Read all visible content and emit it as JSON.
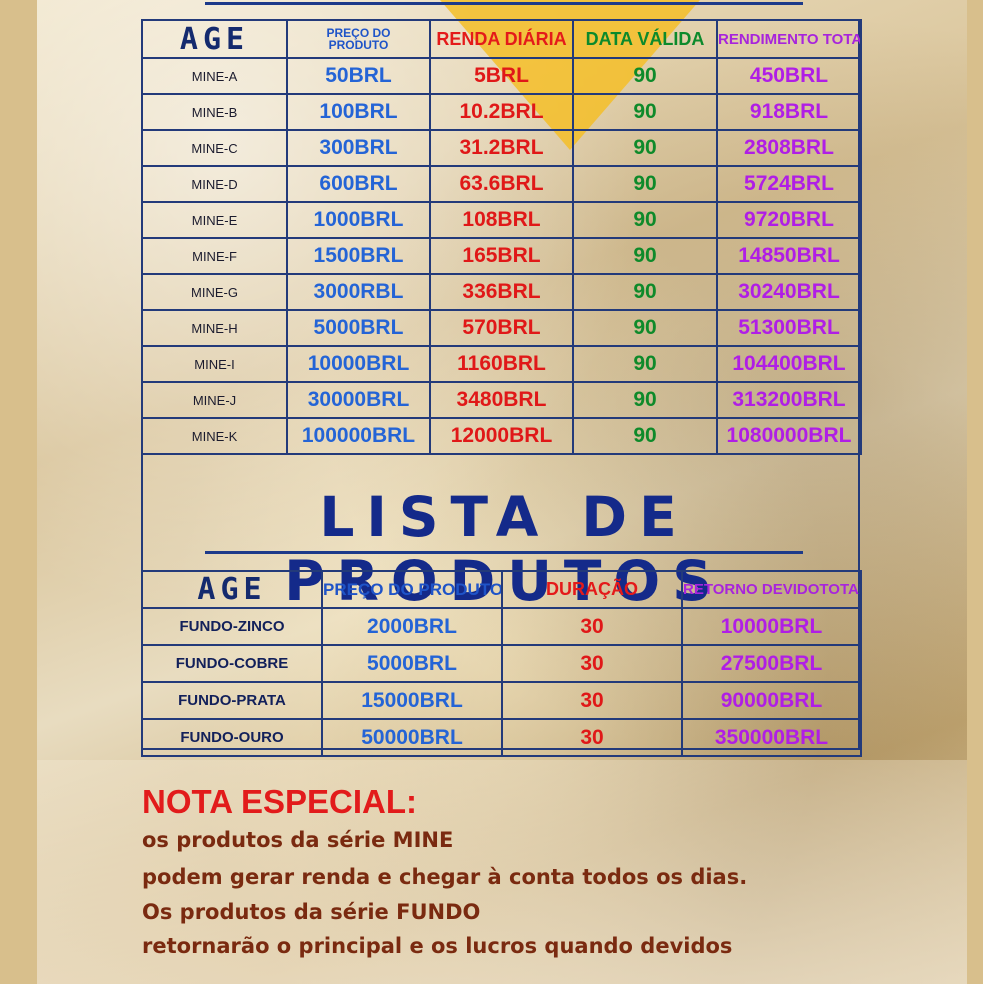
{
  "mine_table": {
    "headers": {
      "age": "AGE",
      "price_line1": "PREÇO DO",
      "price_line2": "PRODUTO",
      "daily": "RENDA DIÁRIA",
      "valid": "DATA VÁLIDA",
      "total": "RENDIMENTO TOTAL"
    },
    "rows": [
      {
        "name": "MINE-A",
        "price": "50BRL",
        "daily": "5BRL",
        "days": "90",
        "total": "450BRL"
      },
      {
        "name": "MINE-B",
        "price": "100BRL",
        "daily": "10.2BRL",
        "days": "90",
        "total": "918BRL"
      },
      {
        "name": "MINE-C",
        "price": "300BRL",
        "daily": "31.2BRL",
        "days": "90",
        "total": "2808BRL"
      },
      {
        "name": "MINE-D",
        "price": "600BRL",
        "daily": "63.6BRL",
        "days": "90",
        "total": "5724BRL"
      },
      {
        "name": "MINE-E",
        "price": "1000BRL",
        "daily": "108BRL",
        "days": "90",
        "total": "9720BRL"
      },
      {
        "name": "MINE-F",
        "price": "1500BRL",
        "daily": "165BRL",
        "days": "90",
        "total": "14850BRL"
      },
      {
        "name": "MINE-G",
        "price": "3000RBL",
        "daily": "336BRL",
        "days": "90",
        "total": "30240BRL"
      },
      {
        "name": "MINE-H",
        "price": "5000BRL",
        "daily": "570BRL",
        "days": "90",
        "total": "51300BRL"
      },
      {
        "name": "MINE-I",
        "price": "10000BRL",
        "daily": "1160BRL",
        "days": "90",
        "total": "104400BRL"
      },
      {
        "name": "MINE-J",
        "price": "30000BRL",
        "daily": "3480BRL",
        "days": "90",
        "total": "313200BRL"
      },
      {
        "name": "MINE-K",
        "price": "100000BRL",
        "daily": "12000BRL",
        "days": "90",
        "total": "1080000BRL"
      }
    ]
  },
  "product_list": {
    "title": "LISTA DE PRODUTOS",
    "headers": {
      "age": "AGE",
      "price": "PREÇO DO PRODUTO",
      "duration": "DURAÇÃO",
      "return": "RETORNO DEVIDOTOTAL"
    },
    "rows": [
      {
        "name": "FUNDO-ZINCO",
        "price": "2000BRL",
        "duration": "30",
        "return": "10000BRL"
      },
      {
        "name": "FUNDO-COBRE",
        "price": "5000BRL",
        "duration": "30",
        "return": "27500BRL"
      },
      {
        "name": "FUNDO-PRATA",
        "price": "15000BRL",
        "duration": "30",
        "return": "90000BRL"
      },
      {
        "name": "FUNDO-OURO",
        "price": "50000BRL",
        "duration": "30",
        "return": "350000BRL"
      }
    ]
  },
  "note": {
    "title": "NOTA ESPECIAL:",
    "lines": [
      "os produtos da série MINE",
      "podem gerar renda e chegar à conta todos os dias.",
      "Os produtos da série FUNDO",
      "retornarão o principal e os lucros quando devidos"
    ]
  },
  "colors": {
    "navy": "#142a6e",
    "blue": "#2464d6",
    "red": "#e01818",
    "green": "#0e8a2a",
    "purple": "#b01ee6",
    "gold": "#f4be28"
  }
}
